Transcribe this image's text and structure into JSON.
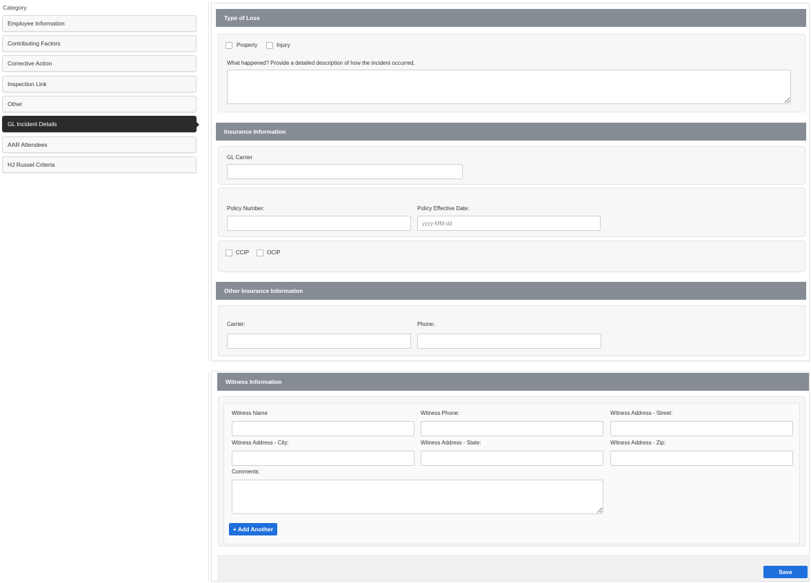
{
  "sidebar": {
    "heading": "Category",
    "items": [
      {
        "label": "Employee Information"
      },
      {
        "label": "Contributing Factors"
      },
      {
        "label": "Corrective Action"
      },
      {
        "label": "Inspection Link"
      },
      {
        "label": "Other"
      },
      {
        "label": "GL Incident Details"
      },
      {
        "label": "AAR Attendees"
      },
      {
        "label": "HJ Russel Criteria"
      }
    ],
    "active_item": "GL Incident Details"
  },
  "type_of_loss": {
    "title": "Type of Loss",
    "property_label": "Property",
    "injury_label": "Injury",
    "description_label": "What happened? Provide a detailed description of how the incident occurred.",
    "description_value": ""
  },
  "insurance": {
    "title": "Insurance Information",
    "gl_carrier_label": "GL Carrier",
    "gl_carrier_value": "",
    "policy_number_label": "Policy Number:",
    "policy_number_value": "",
    "policy_date_label": "Policy Effective Date:",
    "policy_date_placeholder": "yyyy-MM-dd",
    "ccip_label": "CCIP",
    "ocip_label": "OCIP"
  },
  "other_insurance": {
    "title": "Other Insurance Information",
    "carrier_label": "Carrier:",
    "phone_label": "Phone:"
  },
  "witness": {
    "title": "Witness Information",
    "name_label": "Witness Name",
    "phone_label": "Witness Phone:",
    "street_label": "Witness Address - Street:",
    "city_label": "Witness Address - City:",
    "state_label": "Witness Address - State:",
    "zip_label": "Witness Address - Zip:",
    "comments_label": "Comments:",
    "add_another_label": "+ Add Another"
  },
  "save_label": "Save",
  "colors": {
    "header_gray": "#868c94",
    "primary_blue": "#1f6fdc",
    "active_dark": "#2b2b2b"
  }
}
